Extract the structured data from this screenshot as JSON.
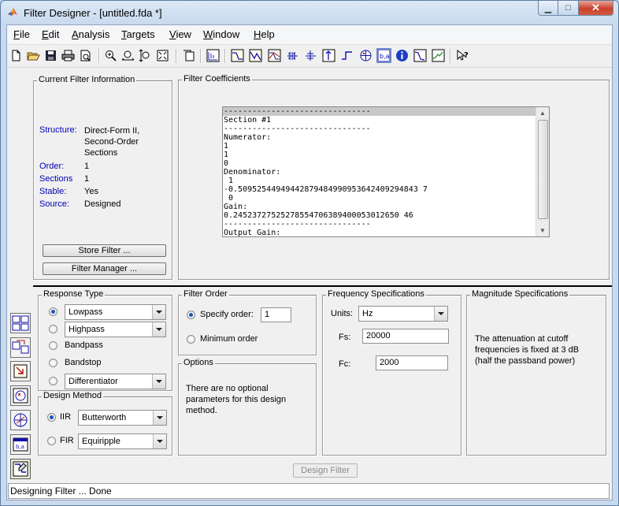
{
  "window": {
    "title": "Filter Designer -  [untitled.fda *]",
    "min_glyph": "▁",
    "max_glyph": "□",
    "close_glyph": "✕"
  },
  "menu": [
    "File",
    "Edit",
    "Analysis",
    "Targets",
    "View",
    "Window",
    "Help"
  ],
  "current_filter_info": {
    "legend": "Current Filter Information",
    "structure_label": "Structure:",
    "structure_lines": [
      "Direct-Form II,",
      "Second-Order",
      "Sections"
    ],
    "order_label": "Order:",
    "order_value": "1",
    "sections_label": "Sections",
    "sections_value": "1",
    "stable_label": "Stable:",
    "stable_value": "Yes",
    "source_label": "Source:",
    "source_value": "Designed",
    "store_button": "Store Filter ...",
    "manager_button": "Filter Manager ..."
  },
  "coefficients": {
    "legend": "Filter Coefficients",
    "lines": [
      "-------------------------------",
      "Section #1",
      "-------------------------------",
      "Numerator:",
      "1",
      "1",
      "0",
      "Denominator:",
      " 1",
      "-0.50952544949442879484990953642409294843 7",
      " 0",
      "Gain:",
      "0.24523727525278554706389400053012650 46",
      "-------------------------------",
      "Output Gain:"
    ]
  },
  "response_type": {
    "legend": "Response Type",
    "options": [
      {
        "label": "",
        "selected": true,
        "combo": "Lowpass"
      },
      {
        "label": "",
        "selected": false,
        "combo": "Highpass"
      },
      {
        "label": "Bandpass",
        "selected": false
      },
      {
        "label": "Bandstop",
        "selected": false
      },
      {
        "label": "",
        "selected": false,
        "combo": "Differentiator"
      }
    ]
  },
  "design_method": {
    "legend": "Design Method",
    "iir_label": "IIR",
    "iir_selected": true,
    "iir_combo": "Butterworth",
    "fir_label": "FIR",
    "fir_selected": false,
    "fir_combo": "Equiripple"
  },
  "filter_order": {
    "legend": "Filter Order",
    "specify_label": "Specify order:",
    "specify_value": "1",
    "specify_selected": true,
    "minimum_label": "Minimum order",
    "minimum_selected": false
  },
  "options": {
    "legend": "Options",
    "text_lines": [
      "There are no optional",
      "parameters for this design",
      "method."
    ]
  },
  "frequency_specs": {
    "legend": "Frequency Specifications",
    "units_label": "Units:",
    "units_value": "Hz",
    "fs_label": "Fs:",
    "fs_value": "20000",
    "fc_label": "Fc:",
    "fc_value": "2000"
  },
  "magnitude_specs": {
    "legend": "Magnitude Specifications",
    "text_lines": [
      "The attenuation at cutoff",
      "frequencies is fixed at 3 dB",
      "(half the passband power)"
    ]
  },
  "design_button": "Design Filter",
  "status": "Designing Filter ... Done"
}
